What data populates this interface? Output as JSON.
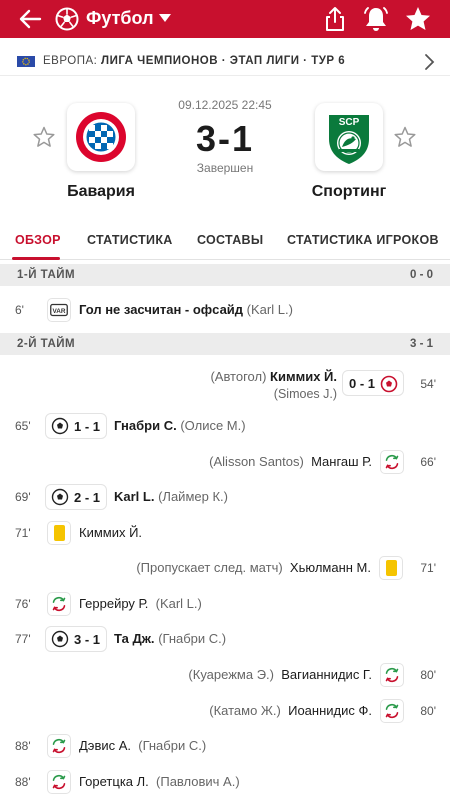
{
  "header": {
    "title": "Футбол",
    "accent": "#c8102e"
  },
  "league": {
    "country": "ЕВРОПА:",
    "name": "ЛИГА ЧЕМПИОНОВ · ЭТАП ЛИГИ · ТУР 6"
  },
  "match": {
    "datetime": "09.12.2025 22:45",
    "score": "3-1",
    "status": "Завершен",
    "home": {
      "name": "Бавария",
      "logo_text": "FC BAYERN MÜNCHEN"
    },
    "away": {
      "name": "Спортинг",
      "logo_text": "SCP SPORTING PORTUGAL"
    }
  },
  "tabs": [
    {
      "label": "ОБЗОР",
      "active": true
    },
    {
      "label": "СТАТИСТИКА"
    },
    {
      "label": "СОСТАВЫ"
    },
    {
      "label": "СТАТИСТИКА ИГРОКОВ"
    }
  ],
  "sections": {
    "first_half": {
      "label": "1-Й ТАЙМ",
      "score": "0 - 0"
    },
    "second_half": {
      "label": "2-Й ТАЙМ",
      "score": "3 - 1"
    }
  },
  "events": {
    "e1": {
      "minute": "6'",
      "icon": "var-icon",
      "text": "Гол не засчитан - офсайд",
      "sub": "(Karl L.)"
    },
    "e2": {
      "minute": "54'",
      "icon": "ball-icon",
      "score": "0 - 1",
      "pre": "(Автогол)",
      "player": "Киммих Й.",
      "sub": "(Simoes J.)"
    },
    "e3": {
      "minute": "65'",
      "icon": "ball-icon",
      "score": "1 - 1",
      "player": "Гнабри С.",
      "sub": "(Олисе М.)"
    },
    "e4": {
      "minute": "66'",
      "icon": "substitution-icon",
      "player": "Мангаш Р.",
      "sub": "(Alisson Santos)"
    },
    "e5": {
      "minute": "69'",
      "icon": "ball-icon",
      "score": "2 - 1",
      "player": "Karl L.",
      "sub": "(Лаймер К.)"
    },
    "e6": {
      "minute": "71'",
      "icon": "yellow-card-icon",
      "player": "Киммих Й."
    },
    "e7": {
      "minute": "71'",
      "icon": "yellow-card-icon",
      "player": "Хьюлманн М.",
      "sub": "(Пропускает след. матч)"
    },
    "e8": {
      "minute": "76'",
      "icon": "substitution-icon",
      "player": "Геррейру Р.",
      "sub": "(Karl L.)"
    },
    "e9": {
      "minute": "77'",
      "icon": "ball-icon",
      "score": "3 - 1",
      "player": "Та Дж.",
      "sub": "(Гнабри С.)"
    },
    "e10": {
      "minute": "80'",
      "icon": "substitution-icon",
      "player": "Вагианнидис Г.",
      "sub": "(Куарежма Э.)"
    },
    "e11": {
      "minute": "80'",
      "icon": "substitution-icon",
      "player": "Иоаннидис Ф.",
      "sub": "(Катамо Ж.)"
    },
    "e12": {
      "minute": "88'",
      "icon": "substitution-icon",
      "player": "Дэвис А.",
      "sub": "(Гнабри С.)"
    },
    "e13": {
      "minute": "88'",
      "icon": "substitution-icon",
      "player": "Горетцка Л.",
      "sub": "(Павлович А.)"
    }
  }
}
